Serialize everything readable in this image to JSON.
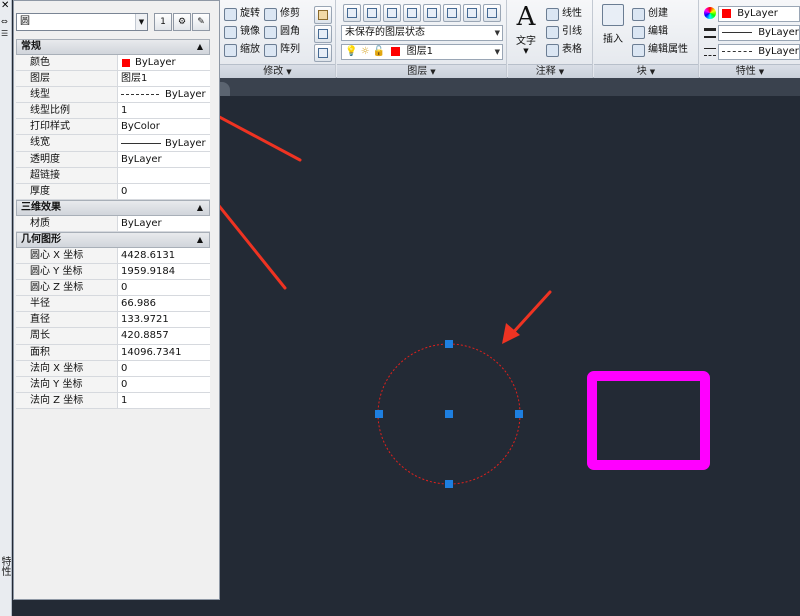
{
  "palette": {
    "object_type": "圆",
    "buttons": [
      "1",
      "⚙",
      "✎"
    ],
    "sections": [
      {
        "title": "常规",
        "rows": [
          {
            "key": "颜色",
            "value": "ByLayer",
            "swatch": "#ff0000"
          },
          {
            "key": "图层",
            "value": "图层1"
          },
          {
            "key": "线型",
            "value": "ByLayer",
            "linestyle": "dash"
          },
          {
            "key": "线型比例",
            "value": "1"
          },
          {
            "key": "打印样式",
            "value": "ByColor"
          },
          {
            "key": "线宽",
            "value": "ByLayer",
            "linestyle": "solid"
          },
          {
            "key": "透明度",
            "value": "ByLayer"
          },
          {
            "key": "超链接",
            "value": ""
          },
          {
            "key": "厚度",
            "value": "0"
          }
        ]
      },
      {
        "title": "三维效果",
        "rows": [
          {
            "key": "材质",
            "value": "ByLayer"
          }
        ]
      },
      {
        "title": "几何图形",
        "rows": [
          {
            "key": "圆心 X 坐标",
            "value": "4428.6131"
          },
          {
            "key": "圆心 Y 坐标",
            "value": "1959.9184"
          },
          {
            "key": "圆心 Z 坐标",
            "value": "0"
          },
          {
            "key": "半径",
            "value": "66.986"
          },
          {
            "key": "直径",
            "value": "133.9721"
          },
          {
            "key": "周长",
            "value": "420.8857"
          },
          {
            "key": "面积",
            "value": "14096.7341"
          },
          {
            "key": "法向 X 坐标",
            "value": "0"
          },
          {
            "key": "法向 Y 坐标",
            "value": "0"
          },
          {
            "key": "法向 Z 坐标",
            "value": "1"
          }
        ]
      }
    ]
  },
  "strip": {
    "close": "✕",
    "vertical_label": "特性"
  },
  "ribbon": {
    "modify": {
      "footer": "修改",
      "items": [
        "旋转",
        "修剪",
        "镜像",
        "圆角",
        "缩放",
        "阵列"
      ]
    },
    "layers": {
      "footer": "图层",
      "state_combo": "未保存的图层状态",
      "layer_combo": "图层1",
      "layer_color": "#ff0000"
    },
    "annotation": {
      "footer": "注释",
      "big_label": "文字",
      "big_glyph": "A",
      "items": [
        "线性",
        "引线",
        "表格"
      ]
    },
    "block": {
      "footer": "块",
      "big_label": "插入",
      "items": [
        "创建",
        "编辑",
        "编辑属性"
      ]
    },
    "properties": {
      "footer": "特性",
      "color_combo": "ByLayer",
      "color": "#ff0000",
      "lineweight_combo": "ByLayer",
      "linetype_combo": "ByLayer"
    }
  },
  "colors": {
    "canvas": "#232a35",
    "circle": "#e0201c",
    "grip": "#1e7fe0",
    "rect": "#ff00ff",
    "arrow": "#ee3322"
  }
}
